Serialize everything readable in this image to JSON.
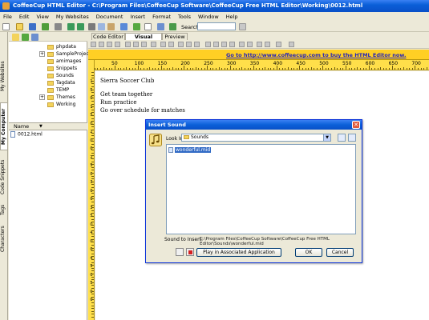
{
  "window": {
    "title": "CoffeeCup HTML Editor - C:\\Program Files\\CoffeeCup Software\\CoffeeCup Free HTML Editor\\Working\\0012.html"
  },
  "menu": [
    "File",
    "Edit",
    "View",
    "My Websites",
    "Document",
    "Insert",
    "Format",
    "Tools",
    "Window",
    "Help"
  ],
  "toolbar": {
    "search_label": "Search:"
  },
  "side_tabs": [
    "My Websites",
    "My Computer",
    "Code Snippets",
    "Tags",
    "Characters"
  ],
  "tree": {
    "folders": [
      "phpdata",
      "SampleProjec",
      "amimages",
      "Snippets",
      "Sounds",
      "Tagdata",
      "TEMP",
      "Themes",
      "Working"
    ],
    "file_column_header": "Name",
    "files": [
      "0012.html"
    ]
  },
  "editor_tabs": [
    "Code Editor",
    "Visual Editor",
    "Preview"
  ],
  "banner": {
    "link_text": "Go to http://www.coffeecup.com to buy the HTML Editor now."
  },
  "ruler_h": [
    "50",
    "100",
    "150",
    "200",
    "250",
    "300",
    "350",
    "400",
    "450",
    "500",
    "550",
    "600",
    "650",
    "700"
  ],
  "ruler_v": [
    "1",
    "5",
    "0",
    "1",
    "5",
    "0",
    "2",
    "0",
    "0",
    "2",
    "5",
    "0",
    "3",
    "0",
    "0",
    "3",
    "5",
    "0",
    "4",
    "0",
    "0",
    "4",
    "5",
    "0",
    "5",
    "0",
    "0"
  ],
  "document": {
    "heading": "Sierra Soccer Club",
    "lines": [
      "Get team together",
      "Run practice",
      "Go over schedule for matches"
    ]
  },
  "dialog": {
    "title": "Insert Sound",
    "look_in_label": "Look In:",
    "look_in_value": "Sounds",
    "files": [
      "wonderful.mid"
    ],
    "sound_to_insert_label": "Sound to Insert:",
    "sound_to_insert_value": "C:\\Program Files\\CoffeeCup Software\\CoffeeCup Free HTML Editor\\Sounds\\wonderful.mid",
    "play_button": "Play in Associated Application",
    "ok_button": "OK",
    "cancel_button": "Cancel"
  },
  "colors": {
    "titlebar": "#0a5fd8",
    "banner": "#ffcf24",
    "banner_link": "#2222bb",
    "ruler": "#ffdf4a",
    "selection": "#316ac5"
  }
}
